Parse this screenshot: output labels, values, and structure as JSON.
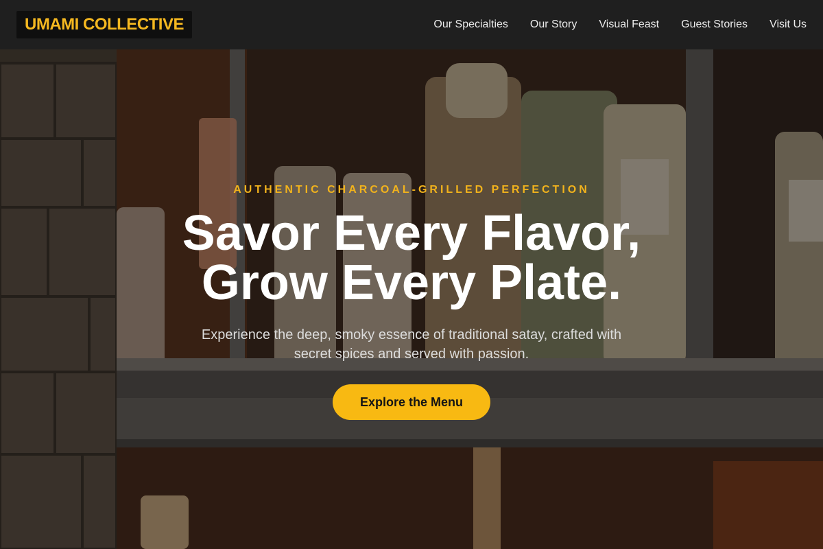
{
  "brand": {
    "logo_text": "UMAMI COLLECTIVE"
  },
  "nav": {
    "links": [
      {
        "label": "Our Specialties"
      },
      {
        "label": "Our Story"
      },
      {
        "label": "Visual Feast"
      },
      {
        "label": "Guest Stories"
      },
      {
        "label": "Visit Us"
      }
    ]
  },
  "hero": {
    "eyebrow": "AUTHENTIC CHARCOAL-GRILLED PERFECTION",
    "headline_line1": "Savor Every Flavor,",
    "headline_line2": "Grow Every Plate.",
    "subhead": "Experience the deep, smoky essence of traditional satay, crafted with secret spices and served with passion.",
    "cta_label": "Explore the Menu",
    "background_image": "pasta-shelf-photo"
  },
  "colors": {
    "accent": "#f8b912",
    "nav_bg": "#1f1f1f",
    "logo_bg": "#0f0f0f",
    "text_light": "#ffffff"
  }
}
